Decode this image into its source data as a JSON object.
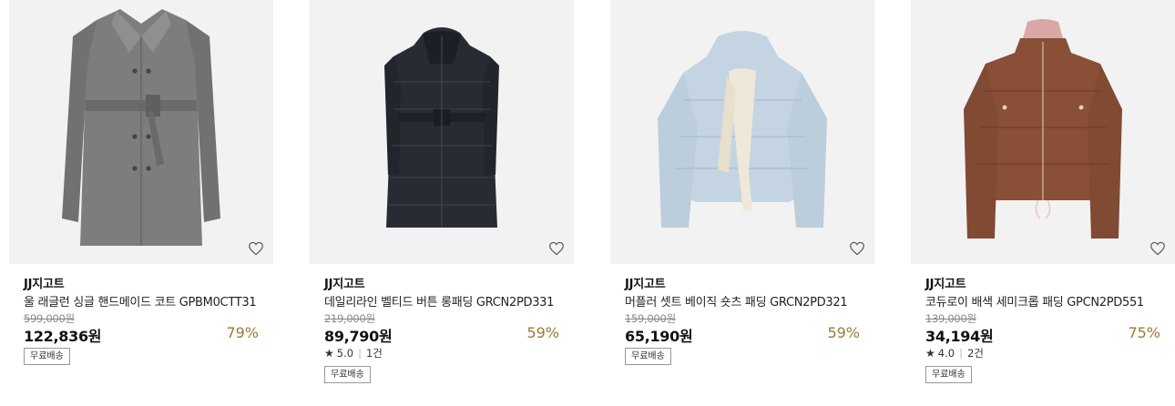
{
  "products": [
    {
      "brand": "JJ지고트",
      "title": "울 래글런 싱글 핸드메이드 코트 GPBM0CTT31",
      "original_price": "599,000원",
      "price": "122,836원",
      "discount": "79%",
      "badge": "무료배송",
      "image": "gray-wool-coat",
      "color": "#7d7d7d"
    },
    {
      "brand": "JJ지고트",
      "title": "데일리라인 벨티드 버튼 롱패딩 GRCN2PD331",
      "original_price": "219,000원",
      "price": "89,790원",
      "discount": "59%",
      "rating": "5.0",
      "reviews": "1건",
      "badge": "무료배송",
      "image": "black-long-padding",
      "color": "#272b33"
    },
    {
      "brand": "JJ지고트",
      "title": "머플러 셋트 베이직 숏츠 패딩 GRCN2PD321",
      "original_price": "159,000원",
      "price": "65,190원",
      "discount": "59%",
      "badge": "무료배송",
      "image": "light-blue-short-padding",
      "color": "#c4d4e2"
    },
    {
      "brand": "JJ지고트",
      "title": "코듀로이 배색 세미크롭 패딩 GPCN2PD551",
      "original_price": "139,000원",
      "price": "34,194원",
      "discount": "75%",
      "rating": "4.0",
      "reviews": "2건",
      "badge": "무료배송",
      "image": "brown-crop-padding",
      "color": "#8a4f37"
    }
  ],
  "accent": {
    "discount_color": "#9c7a33"
  },
  "icons": {
    "wishlist": "heart-outline-icon",
    "rating": "star-icon"
  }
}
